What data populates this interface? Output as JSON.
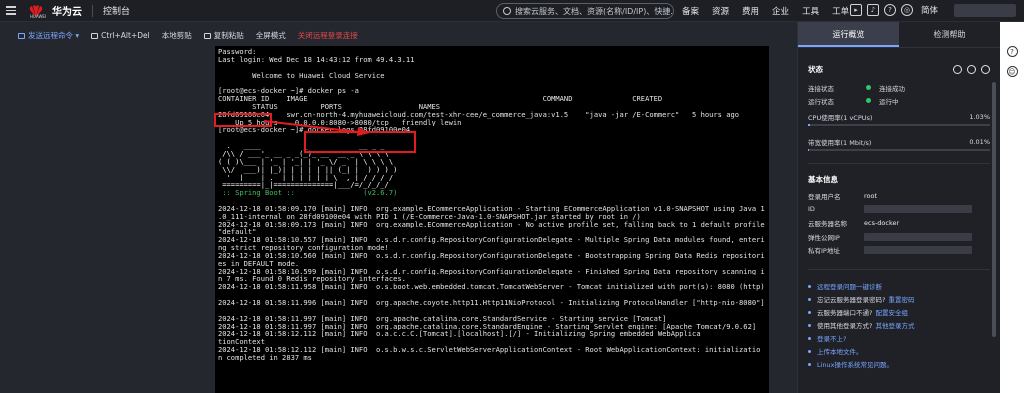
{
  "topbar": {
    "brand": "华为云",
    "logo_sub": "HUAWEI",
    "console": "控制台",
    "search_placeholder": "搜索云服务、文档、资源(名称/ID/IP)、快捷...",
    "nav": [
      "备案",
      "资源",
      "费用",
      "企业",
      "工具",
      "工单"
    ],
    "lang": "简体"
  },
  "toolbar": {
    "send": "发送远程命令 ▾",
    "ctrl_alt_del": "Ctrl+Alt+Del",
    "local_clipboard": "本地剪贴",
    "copy_paste": "复制粘贴",
    "fullscreen": "全屏模式",
    "warning": "关闭远程登录连接"
  },
  "terminal": {
    "lines": [
      {
        "t": "Password:"
      },
      {
        "t": "Last login: Wed Dec 18 14:43:12 from 49.4.3.11"
      },
      {
        "t": ""
      },
      {
        "t": "        Welcome to Huawei Cloud Service"
      },
      {
        "t": ""
      },
      {
        "t": "[root@ecs-docker ~]# docker ps -a"
      },
      {
        "t": "CONTAINER ID    IMAGE                                                       COMMAND              CREATED"
      },
      {
        "t": "        STATUS          PORTS                  NAMES"
      },
      {
        "t": "28fd09100e04    swr.cn-north-4.myhuaweicloud.com/test-xhr-cee/e_commerce_java:v1.5    \"java -jar /E-Commerc\"   5 hours ago"
      },
      {
        "t": "    Up 5 hours    0.0.0.0:8080->8080/tcp   friendly_lewin"
      },
      {
        "t": "[root@ecs-docker ~]# docker logs 28fd09100e04"
      },
      {
        "t": ""
      },
      {
        "t": "  .   ____          _            __ _ _",
        "c": "t-white"
      },
      {
        "t": " /\\\\ / ___'_ __ _ _(_)_ __  __ _ \\ \\ \\ \\",
        "c": "t-white"
      },
      {
        "t": "( ( )\\___ | '_ | '_| | '_ \\/ _` | \\ \\ \\ \\",
        "c": "t-white"
      },
      {
        "t": " \\\\/  ___)| |_)| | | | | || (_| |  ) ) ) )",
        "c": "t-white"
      },
      {
        "t": "  '  |____| .__|_| |_|_| |_\\__, | / / / /",
        "c": "t-white"
      },
      {
        "t": " =========|_|==============|___/=/_/_/_/",
        "c": "t-white"
      },
      {
        "t": " :: Spring Boot ::                (v2.6.7)",
        "c": "t-green"
      },
      {
        "t": ""
      },
      {
        "t": "2024-12-18 01:58:09.170 [main] INFO  org.example.ECommerceApplication - Starting ECommerceApplication v1.0-SNAPSHOT using Java 1.8"
      },
      {
        "t": ".0_111-internal on 28fd09100e04 with PID 1 (/E-Commerce-Java-1.0-SNAPSHOT.jar started by root in /)"
      },
      {
        "t": "2024-12-18 01:58:09.173 [main] INFO  org.example.ECommerceApplication - No active profile set, falling back to 1 default profile:"
      },
      {
        "t": "\"default\""
      },
      {
        "t": "2024-12-18 01:58:10.557 [main] INFO  o.s.d.r.config.RepositoryConfigurationDelegate - Multiple Spring Data modules found, enteri"
      },
      {
        "t": "ng strict repository configuration mode!"
      },
      {
        "t": "2024-12-18 01:58:10.560 [main] INFO  o.s.d.r.config.RepositoryConfigurationDelegate - Bootstrapping Spring Data Redis repositori"
      },
      {
        "t": "es in DEFAULT mode."
      },
      {
        "t": "2024-12-18 01:58:10.599 [main] INFO  o.s.d.r.config.RepositoryConfigurationDelegate - Finished Spring Data repository scanning i"
      },
      {
        "t": "n 7 ms. Found 0 Redis repository interfaces."
      },
      {
        "t": "2024-12-18 01:58:11.958 [main] INFO  o.s.boot.web.embedded.tomcat.TomcatWebServer - Tomcat initialized with port(s): 8080 (http)"
      },
      {
        "t": ""
      },
      {
        "t": "2024-12-18 01:58:11.996 [main] INFO  org.apache.coyote.http11.Http11NioProtocol - Initializing ProtocolHandler [\"http-nio-8080\"]"
      },
      {
        "t": ""
      },
      {
        "t": "2024-12-18 01:58:11.997 [main] INFO  org.apache.catalina.core.StandardService - Starting service [Tomcat]"
      },
      {
        "t": "2024-12-18 01:58:11.997 [main] INFO  org.apache.catalina.core.StandardEngine - Starting Servlet engine: [Apache Tomcat/9.0.62]"
      },
      {
        "t": "2024-12-18 01:58:12.112 [main] INFO  o.a.c.c.C.[Tomcat].[localhost].[/] - Initializing Spring embedded WebApplica"
      },
      {
        "t": "tionContext"
      },
      {
        "t": "2024-12-18 01:58:12.112 [main] INFO  o.s.b.w.s.c.ServletWebServerApplicationContext - Root WebApplicationContext: initializatio"
      },
      {
        "t": "n completed in 2837 ms"
      }
    ]
  },
  "panel": {
    "tabs": [
      "运行概览",
      "检测帮助"
    ],
    "status_title": "状态",
    "status_rows": [
      {
        "k": "连接状态",
        "v": "连接成功"
      },
      {
        "k": "运行状态",
        "v": "运行中"
      }
    ],
    "metrics": [
      {
        "k": "CPU使用率(1 vCPUs)",
        "v": "1.03%",
        "ratio": 0.0103
      },
      {
        "k": "带宽使用率(1 Mbit/s)",
        "v": "0.01%",
        "ratio": 0.0001
      }
    ],
    "info_title": "基本信息",
    "info_rows": [
      {
        "k": "登录用户名",
        "v": "root"
      },
      {
        "k": "ID",
        "v": ""
      },
      {
        "k": "云服务器名称",
        "v": "ecs-docker"
      },
      {
        "k": "弹性公网IP",
        "v": ""
      },
      {
        "k": "私有IP地址",
        "v": ""
      }
    ],
    "links": [
      {
        "text": "远程登录问题一键诊断",
        "full": true
      },
      {
        "text": "忘记云服务器登录密码?",
        "a": "重置密码"
      },
      {
        "text": "云服务器端口不通?",
        "a": "配置安全组"
      },
      {
        "text": "使用其他登录方式?",
        "a": "其他登录方式"
      },
      {
        "text": "登录不上?",
        "full": true
      },
      {
        "text": "上传本地文件。",
        "full": true
      },
      {
        "text": "Linux操作系统常见问题。",
        "full": true
      }
    ]
  },
  "side_strip": {
    "help": "?",
    "feedback": "☺"
  }
}
